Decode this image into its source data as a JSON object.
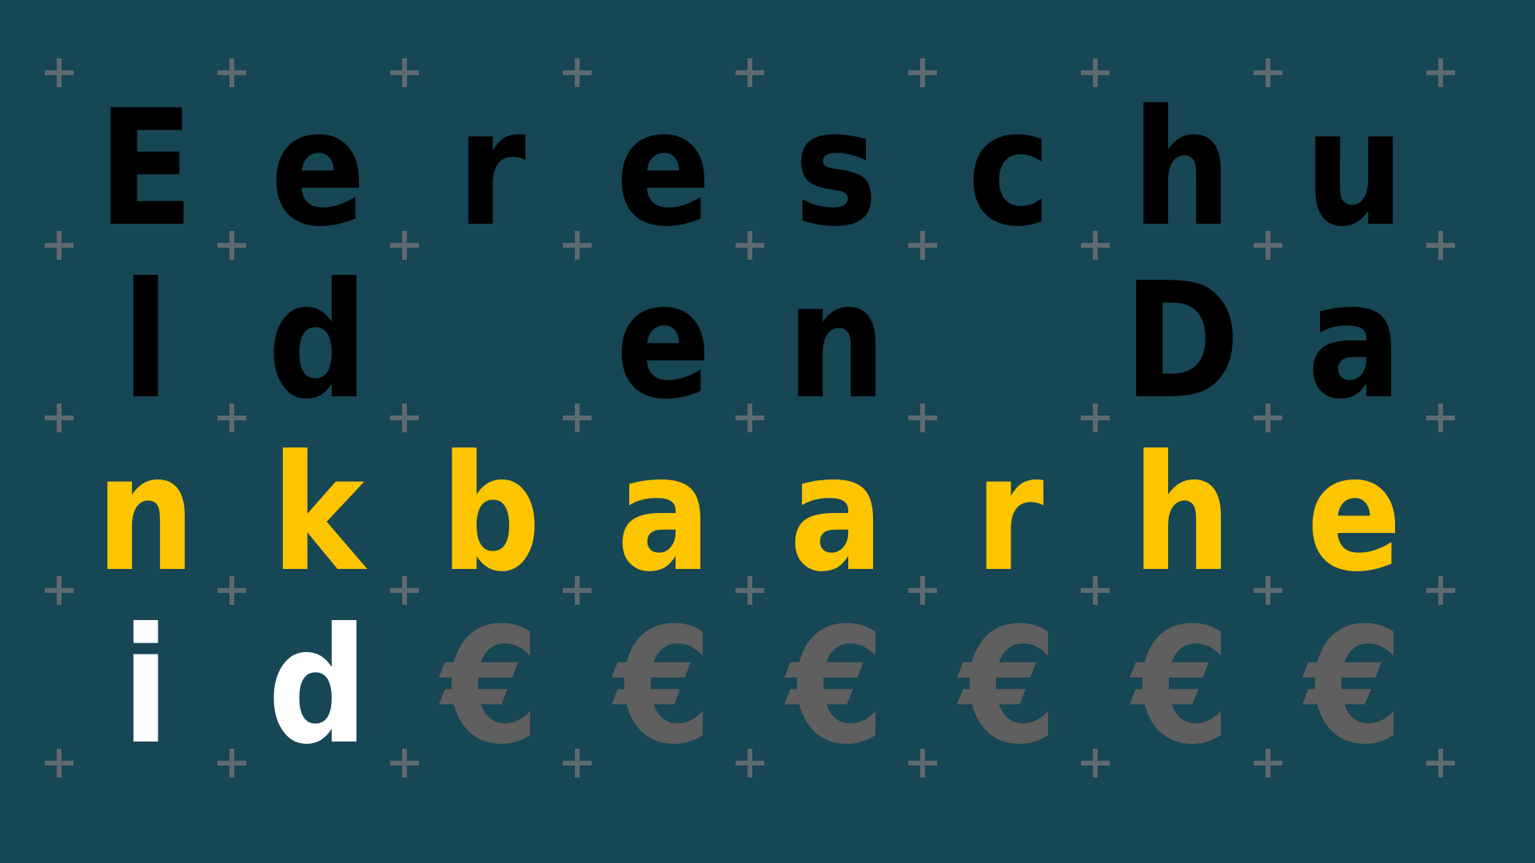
{
  "colors": {
    "background": "#174654",
    "grid_plus": "#5f6a6e",
    "black": "#000000",
    "yellow": "#fcc500",
    "white": "#ffffff",
    "gray": "#5f5f5f"
  },
  "rows": [
    [
      {
        "char": "E",
        "color": "black"
      },
      {
        "char": "e",
        "color": "black"
      },
      {
        "char": "r",
        "color": "black"
      },
      {
        "char": "e",
        "color": "black"
      },
      {
        "char": "s",
        "color": "black"
      },
      {
        "char": "c",
        "color": "black"
      },
      {
        "char": "h",
        "color": "black"
      },
      {
        "char": "u",
        "color": "black"
      }
    ],
    [
      {
        "char": "l",
        "color": "black"
      },
      {
        "char": "d",
        "color": "black"
      },
      {
        "char": "",
        "color": "black"
      },
      {
        "char": "e",
        "color": "black"
      },
      {
        "char": "n",
        "color": "black"
      },
      {
        "char": "",
        "color": "black"
      },
      {
        "char": "D",
        "color": "black"
      },
      {
        "char": "a",
        "color": "black"
      }
    ],
    [
      {
        "char": "n",
        "color": "yellow"
      },
      {
        "char": "k",
        "color": "yellow"
      },
      {
        "char": "b",
        "color": "yellow"
      },
      {
        "char": "a",
        "color": "yellow"
      },
      {
        "char": "a",
        "color": "yellow"
      },
      {
        "char": "r",
        "color": "yellow"
      },
      {
        "char": "h",
        "color": "yellow"
      },
      {
        "char": "e",
        "color": "yellow"
      }
    ],
    [
      {
        "char": "i",
        "color": "white"
      },
      {
        "char": "d",
        "color": "white"
      },
      {
        "char": "€",
        "color": "gray"
      },
      {
        "char": "€",
        "color": "gray"
      },
      {
        "char": "€",
        "color": "gray"
      },
      {
        "char": "€",
        "color": "gray"
      },
      {
        "char": "€",
        "color": "gray"
      },
      {
        "char": "€",
        "color": "gray"
      }
    ]
  ]
}
